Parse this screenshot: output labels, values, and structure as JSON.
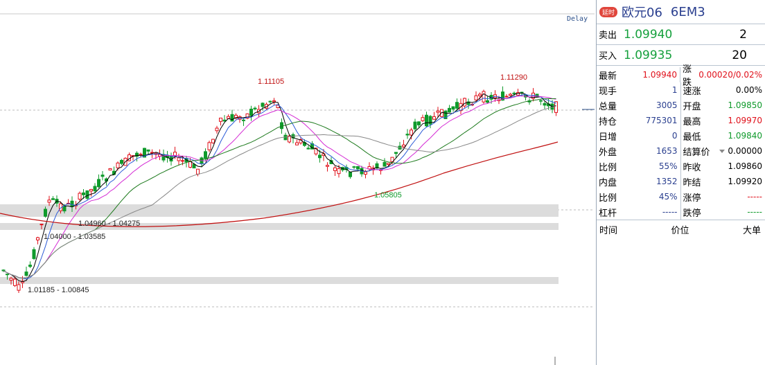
{
  "chart": {
    "delay_label": "Delay",
    "price_labels": {
      "high_left": "1.11105",
      "high_right": "1.11290",
      "low_mid": "1.05805"
    },
    "zones": [
      {
        "label": "1.04960 - 1.04275"
      },
      {
        "label": "1.04000 - 1.03585"
      },
      {
        "label": "1.01185 - 1.00845"
      }
    ],
    "colors": {
      "up": "#e0101a",
      "down": "#0f9a2b",
      "ma5": "#000000",
      "ma10": "#2b5bd7",
      "ma20": "#d42ad4",
      "ma40": "#1d7a1d",
      "ma60": "#888888",
      "ma120": "#c01010"
    }
  },
  "panel": {
    "delay_badge": "延时",
    "symbol": "欧元06",
    "code": "6EM3",
    "ask": {
      "label": "卖出",
      "price": "1.09940",
      "vol": "2"
    },
    "bid": {
      "label": "买入",
      "price": "1.09935",
      "vol": "20"
    },
    "rows": [
      {
        "l_label": "最新",
        "l_val": "1.09940",
        "l_color": "red",
        "r_label": "涨跌",
        "r_val": "0.00020/0.02%",
        "r_color": "red"
      },
      {
        "l_label": "现手",
        "l_val": "1",
        "l_color": "blue",
        "r_label": "速涨",
        "r_val": "0.00%",
        "r_color": "dark"
      },
      {
        "l_label": "总量",
        "l_val": "3005",
        "l_color": "blue",
        "r_label": "开盘",
        "r_val": "1.09850",
        "r_color": "green"
      },
      {
        "l_label": "持仓",
        "l_val": "775301",
        "l_color": "blue",
        "r_label": "最高",
        "r_val": "1.09970",
        "r_color": "red"
      },
      {
        "l_label": "日增",
        "l_val": "0",
        "l_color": "blue",
        "r_label": "最低",
        "r_val": "1.09840",
        "r_color": "green"
      },
      {
        "l_label": "外盘",
        "l_val": "1653",
        "l_color": "blue",
        "r_label": "结算价",
        "r_val": "0.00000",
        "r_color": "dark",
        "caret": true
      },
      {
        "l_label": "比例",
        "l_val": "55%",
        "l_color": "blue",
        "r_label": "昨收",
        "r_val": "1.09860",
        "r_color": "dark"
      },
      {
        "l_label": "内盘",
        "l_val": "1352",
        "l_color": "blue",
        "r_label": "昨结",
        "r_val": "1.09920",
        "r_color": "dark"
      },
      {
        "l_label": "比例",
        "l_val": "45%",
        "l_color": "blue",
        "r_label": "涨停",
        "r_val": "-----",
        "r_color": "red"
      },
      {
        "l_label": "杠杆",
        "l_val": "-----",
        "l_color": "blue",
        "r_label": "跌停",
        "r_val": "-----",
        "r_color": "green"
      }
    ],
    "tick_headers": {
      "time": "时间",
      "price": "价位",
      "size": "大单"
    }
  }
}
